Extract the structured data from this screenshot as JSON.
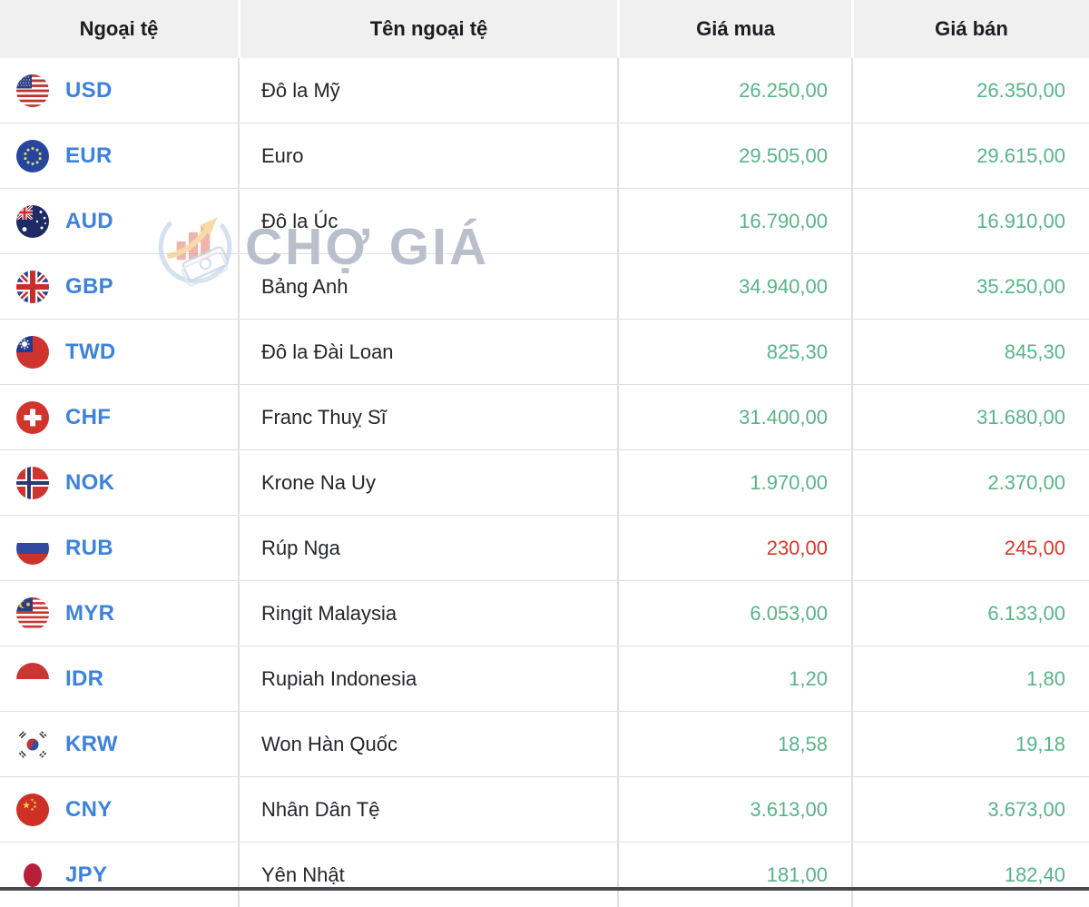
{
  "header": {
    "columns": [
      "Ngoại tệ",
      "Tên ngoại tệ",
      "Giá mua",
      "Giá bán"
    ]
  },
  "watermark": {
    "text": "CHỢ GIÁ",
    "logo_icon": "cho-gia-logo-icon"
  },
  "colors": {
    "code_blue": "#3d82dd",
    "price_green": "#58b488",
    "price_red": "#d6372d",
    "header_bg": "#f0f0f0",
    "header_text": "#1b1d21",
    "name_text": "#24262a",
    "grid_line": "#dfdfdf"
  },
  "rows": [
    {
      "code": "USD",
      "flag": "usd-flag-icon",
      "name": "Đô la Mỹ",
      "buy": "26.250,00",
      "sell": "26.350,00",
      "color": "green"
    },
    {
      "code": "EUR",
      "flag": "eur-flag-icon",
      "name": "Euro",
      "buy": "29.505,00",
      "sell": "29.615,00",
      "color": "green"
    },
    {
      "code": "AUD",
      "flag": "aud-flag-icon",
      "name": "Đô la Úc",
      "buy": "16.790,00",
      "sell": "16.910,00",
      "color": "green"
    },
    {
      "code": "GBP",
      "flag": "gbp-flag-icon",
      "name": "Bảng Anh",
      "buy": "34.940,00",
      "sell": "35.250,00",
      "color": "green"
    },
    {
      "code": "TWD",
      "flag": "twd-flag-icon",
      "name": "Đô la Đài Loan",
      "buy": "825,30",
      "sell": "845,30",
      "color": "green"
    },
    {
      "code": "CHF",
      "flag": "chf-flag-icon",
      "name": "Franc Thuỵ Sĩ",
      "buy": "31.400,00",
      "sell": "31.680,00",
      "color": "green"
    },
    {
      "code": "NOK",
      "flag": "nok-flag-icon",
      "name": "Krone Na Uy",
      "buy": "1.970,00",
      "sell": "2.370,00",
      "color": "green"
    },
    {
      "code": "RUB",
      "flag": "rub-flag-icon",
      "name": "Rúp Nga",
      "buy": "230,00",
      "sell": "245,00",
      "color": "red"
    },
    {
      "code": "MYR",
      "flag": "myr-flag-icon",
      "name": "Ringit Malaysia",
      "buy": "6.053,00",
      "sell": "6.133,00",
      "color": "green"
    },
    {
      "code": "IDR",
      "flag": "idr-flag-icon",
      "name": "Rupiah Indonesia",
      "buy": "1,20",
      "sell": "1,80",
      "color": "green"
    },
    {
      "code": "KRW",
      "flag": "krw-flag-icon",
      "name": "Won Hàn Quốc",
      "buy": "18,58",
      "sell": "19,18",
      "color": "green"
    },
    {
      "code": "CNY",
      "flag": "cny-flag-icon",
      "name": "Nhân Dân Tệ",
      "buy": "3.613,00",
      "sell": "3.673,00",
      "color": "green"
    },
    {
      "code": "JPY",
      "flag": "jpy-flag-icon",
      "name": "Yên Nhật",
      "buy": "181,00",
      "sell": "182,40",
      "color": "green"
    }
  ]
}
